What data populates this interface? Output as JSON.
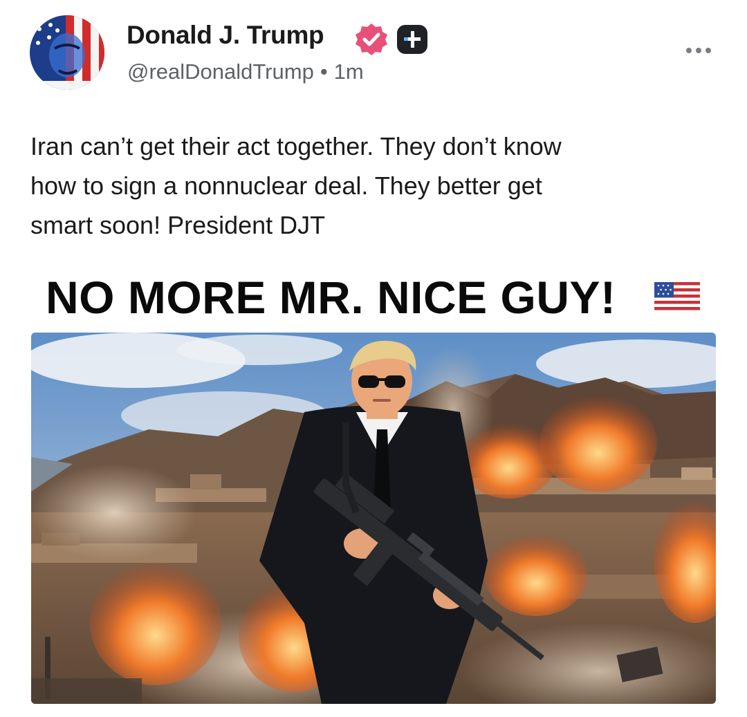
{
  "post": {
    "author_name": "Donald J. Trump",
    "handle": "@realDonaldTrump",
    "separator": "•",
    "timestamp": "1m",
    "body": "Iran can’t get their act together. They don’t know\nhow to sign a nonnuclear deal. They better get\nsmart soon! President DJT",
    "image_headline": "NO MORE MR. NICE GUY!",
    "icons": {
      "avatar": "profile-avatar",
      "verified": "verified-badge-icon",
      "plus": "plus-badge-icon",
      "more": "more-options-icon",
      "flag": "us-flag-emoji-icon"
    },
    "colors": {
      "verified_badge": "#e8507a",
      "handle_text": "#5e6165",
      "headline_text": "#0a0a0a"
    }
  }
}
